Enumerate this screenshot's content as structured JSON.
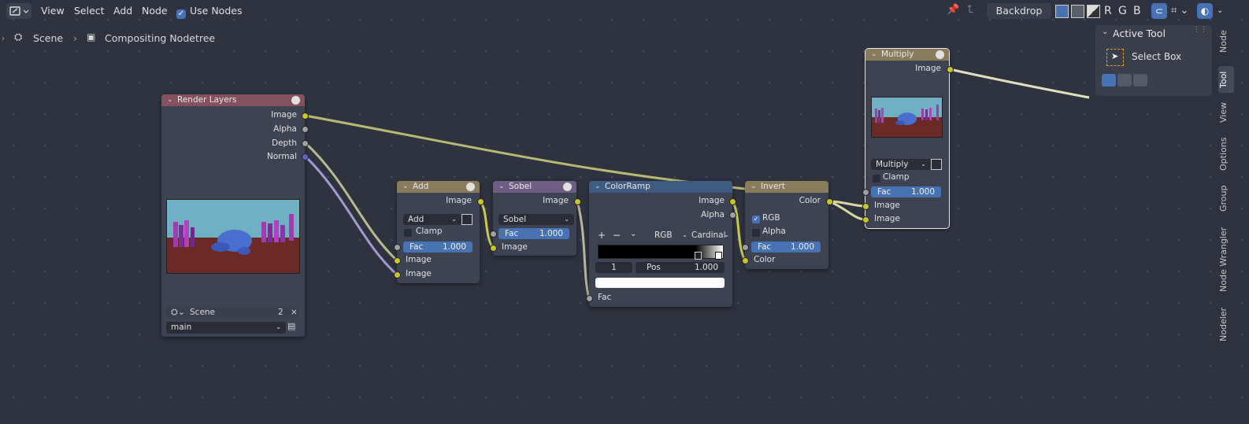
{
  "header": {
    "menu": [
      "View",
      "Select",
      "Add",
      "Node"
    ],
    "use_nodes_label": "Use Nodes",
    "backdrop_label": "Backdrop",
    "channels": [
      "R",
      "G",
      "B"
    ]
  },
  "breadcrumb": {
    "scene": "Scene",
    "tree": "Compositing Nodetree"
  },
  "nodes": {
    "render_layers": {
      "title": "Render Layers",
      "outputs": [
        "Image",
        "Alpha",
        "Depth",
        "Normal"
      ],
      "scene_label": "Scene",
      "scene_users": "2",
      "layer": "main"
    },
    "add": {
      "title": "Add",
      "mode": "Add",
      "clamp": "Clamp",
      "fac_label": "Fac",
      "fac_value": "1.000",
      "output": "Image",
      "inputs": [
        "Image",
        "Image"
      ]
    },
    "sobel": {
      "title": "Sobel",
      "mode": "Sobel",
      "fac_label": "Fac",
      "fac_value": "1.000",
      "output": "Image",
      "input": "Image"
    },
    "colorramp": {
      "title": "ColorRamp",
      "outputs": [
        "Image",
        "Alpha"
      ],
      "color_mode": "RGB",
      "interpolation": "Cardinal",
      "index": "1",
      "pos_label": "Pos",
      "pos_value": "1.000",
      "input": "Fac"
    },
    "invert": {
      "title": "Invert",
      "output": "Color",
      "rgb": "RGB",
      "alpha": "Alpha",
      "fac_label": "Fac",
      "fac_value": "1.000",
      "input": "Color"
    },
    "multiply": {
      "title": "Multiply",
      "output": "Image",
      "mode": "Multiply",
      "clamp": "Clamp",
      "fac_label": "Fac",
      "fac_value": "1.000",
      "inputs": [
        "Image",
        "Image"
      ]
    }
  },
  "panel": {
    "title": "Active Tool",
    "tool": "Select Box"
  },
  "side_tabs": [
    "Node",
    "Tool",
    "View",
    "Options",
    "Group",
    "Node Wrangler",
    "Nodeler"
  ],
  "colors": {
    "accent": "#4772b3",
    "socket_color": "#c7c729",
    "socket_value": "#a1a1a1",
    "socket_vector": "#6363c7"
  }
}
